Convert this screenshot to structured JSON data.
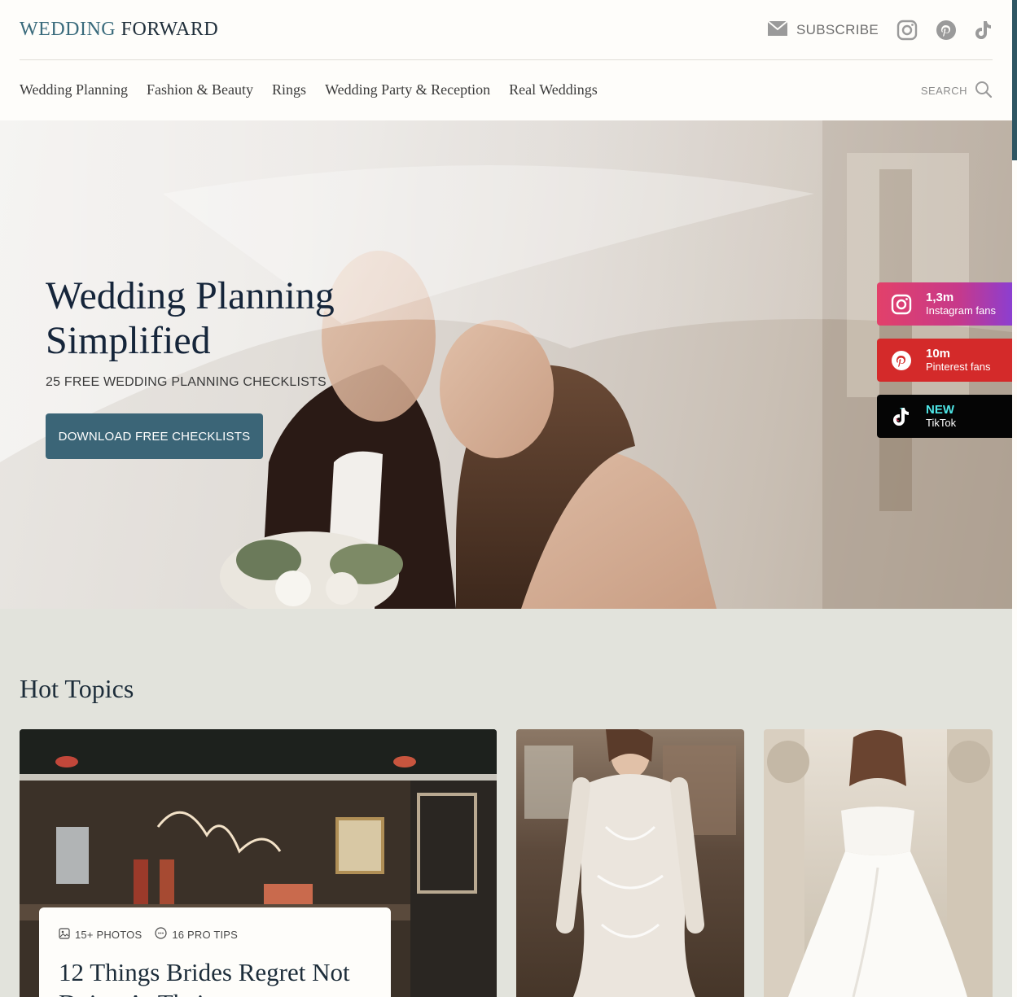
{
  "header": {
    "logo_part1": "WEDDING",
    "logo_part2": " FORWARD",
    "subscribe_label": "SUBSCRIBE"
  },
  "nav": {
    "items": [
      "Wedding Planning",
      "Fashion & Beauty",
      "Rings",
      "Wedding Party & Reception",
      "Real Weddings"
    ],
    "search_label": "SEARCH"
  },
  "hero": {
    "title": "Wedding Planning Simplified",
    "subtitle": "25 FREE WEDDING PLANNING CHECKLISTS",
    "button_label": "DOWNLOAD FREE CHECKLISTS"
  },
  "fans": {
    "instagram": {
      "count": "1,3m",
      "label": "Instagram fans"
    },
    "pinterest": {
      "count": "10m",
      "label": "Pinterest fans"
    },
    "tiktok": {
      "count": "NEW",
      "label": "TikTok"
    }
  },
  "hot_topics": {
    "title": "Hot Topics",
    "featured": {
      "photos": "15+ PHOTOS",
      "tips": "16 PRO TIPS",
      "title": "12 Things Brides Regret Not Doing At Their"
    }
  },
  "colors": {
    "accent": "#3b6577",
    "background": "#fefdfa",
    "section_bg": "#e2e3dc",
    "instagram": "#e2416a",
    "pinterest": "#d42a2a",
    "tiktok": "#050505"
  },
  "icons": [
    "envelope-icon",
    "instagram-icon",
    "pinterest-icon",
    "tiktok-icon",
    "search-icon",
    "image-icon",
    "chat-icon"
  ]
}
